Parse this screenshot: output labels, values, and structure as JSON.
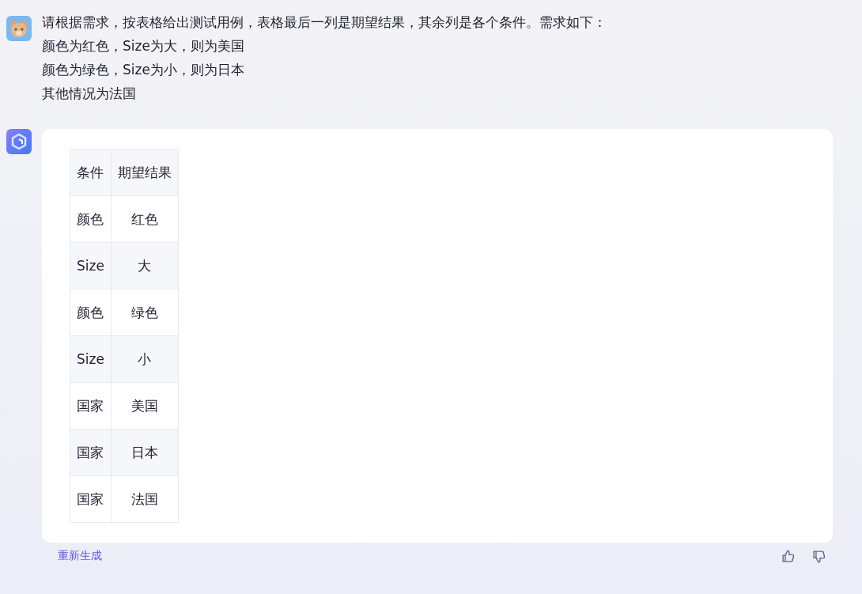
{
  "user_message": {
    "lines": [
      "请根据需求，按表格给出测试用例，表格最后一列是期望结果，其余列是各个条件。需求如下：",
      "颜色为红色，Size为大，则为美国",
      "颜色为绿色，Size为小，则为日本",
      "其他情况为法国"
    ]
  },
  "bot_reply": {
    "table": {
      "columns": [
        "条件",
        "期望结果"
      ],
      "rows": [
        [
          "颜色",
          "红色"
        ],
        [
          "Size",
          "大"
        ],
        [
          "颜色",
          "绿色"
        ],
        [
          "Size",
          "小"
        ],
        [
          "国家",
          "美国"
        ],
        [
          "国家",
          "日本"
        ],
        [
          "国家",
          "法国"
        ]
      ]
    },
    "regenerate_link": "重新生成"
  }
}
